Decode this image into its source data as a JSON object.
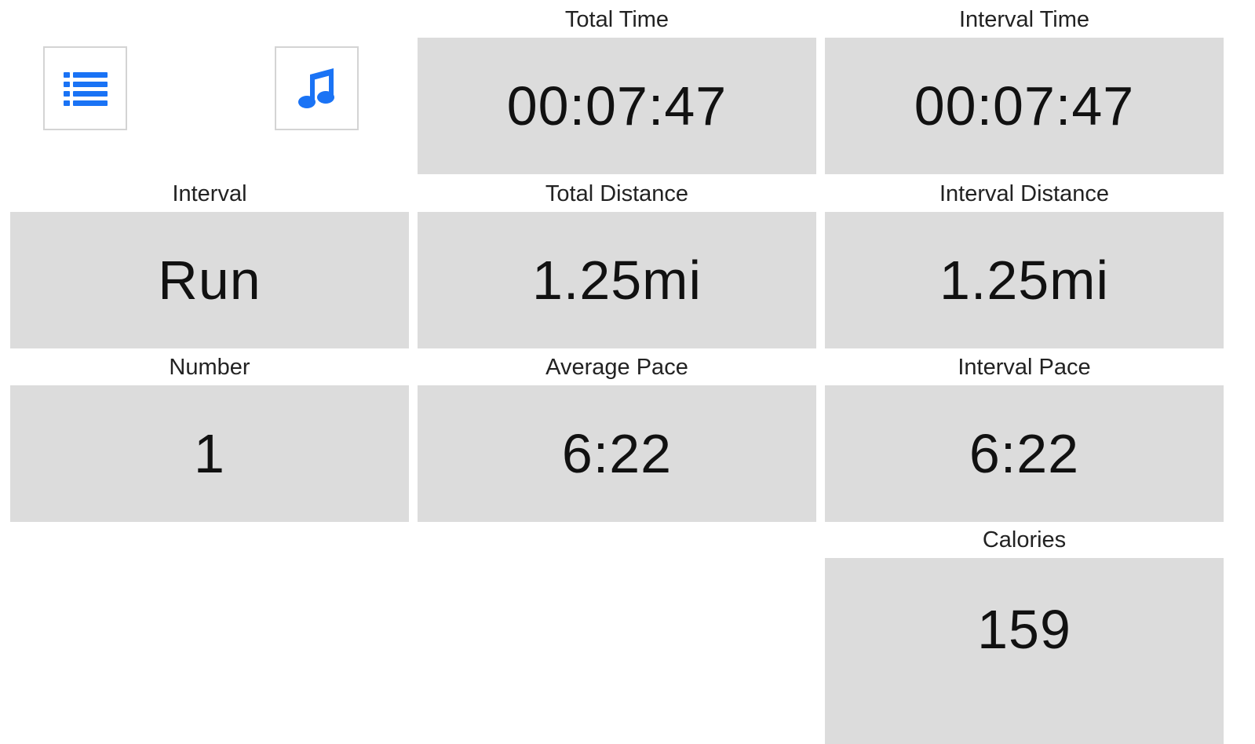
{
  "toolbar": {
    "list_icon": "list-icon",
    "music_icon": "music-note-icon",
    "accent_color": "#1a73f5"
  },
  "stats": {
    "total_time": {
      "label": "Total Time",
      "value": "00:07:47"
    },
    "interval_time": {
      "label": "Interval Time",
      "value": "00:07:47"
    },
    "interval": {
      "label": "Interval",
      "value": "Run"
    },
    "total_distance": {
      "label": "Total Distance",
      "value": "1.25mi"
    },
    "interval_distance": {
      "label": "Interval Distance",
      "value": "1.25mi"
    },
    "number": {
      "label": "Number",
      "value": "1"
    },
    "average_pace": {
      "label": "Average Pace",
      "value": "6:22"
    },
    "interval_pace": {
      "label": "Interval Pace",
      "value": "6:22"
    },
    "calories": {
      "label": "Calories",
      "value": "159"
    }
  },
  "colors": {
    "tile_background": "#dcdcdc",
    "page_background": "#ffffff"
  }
}
